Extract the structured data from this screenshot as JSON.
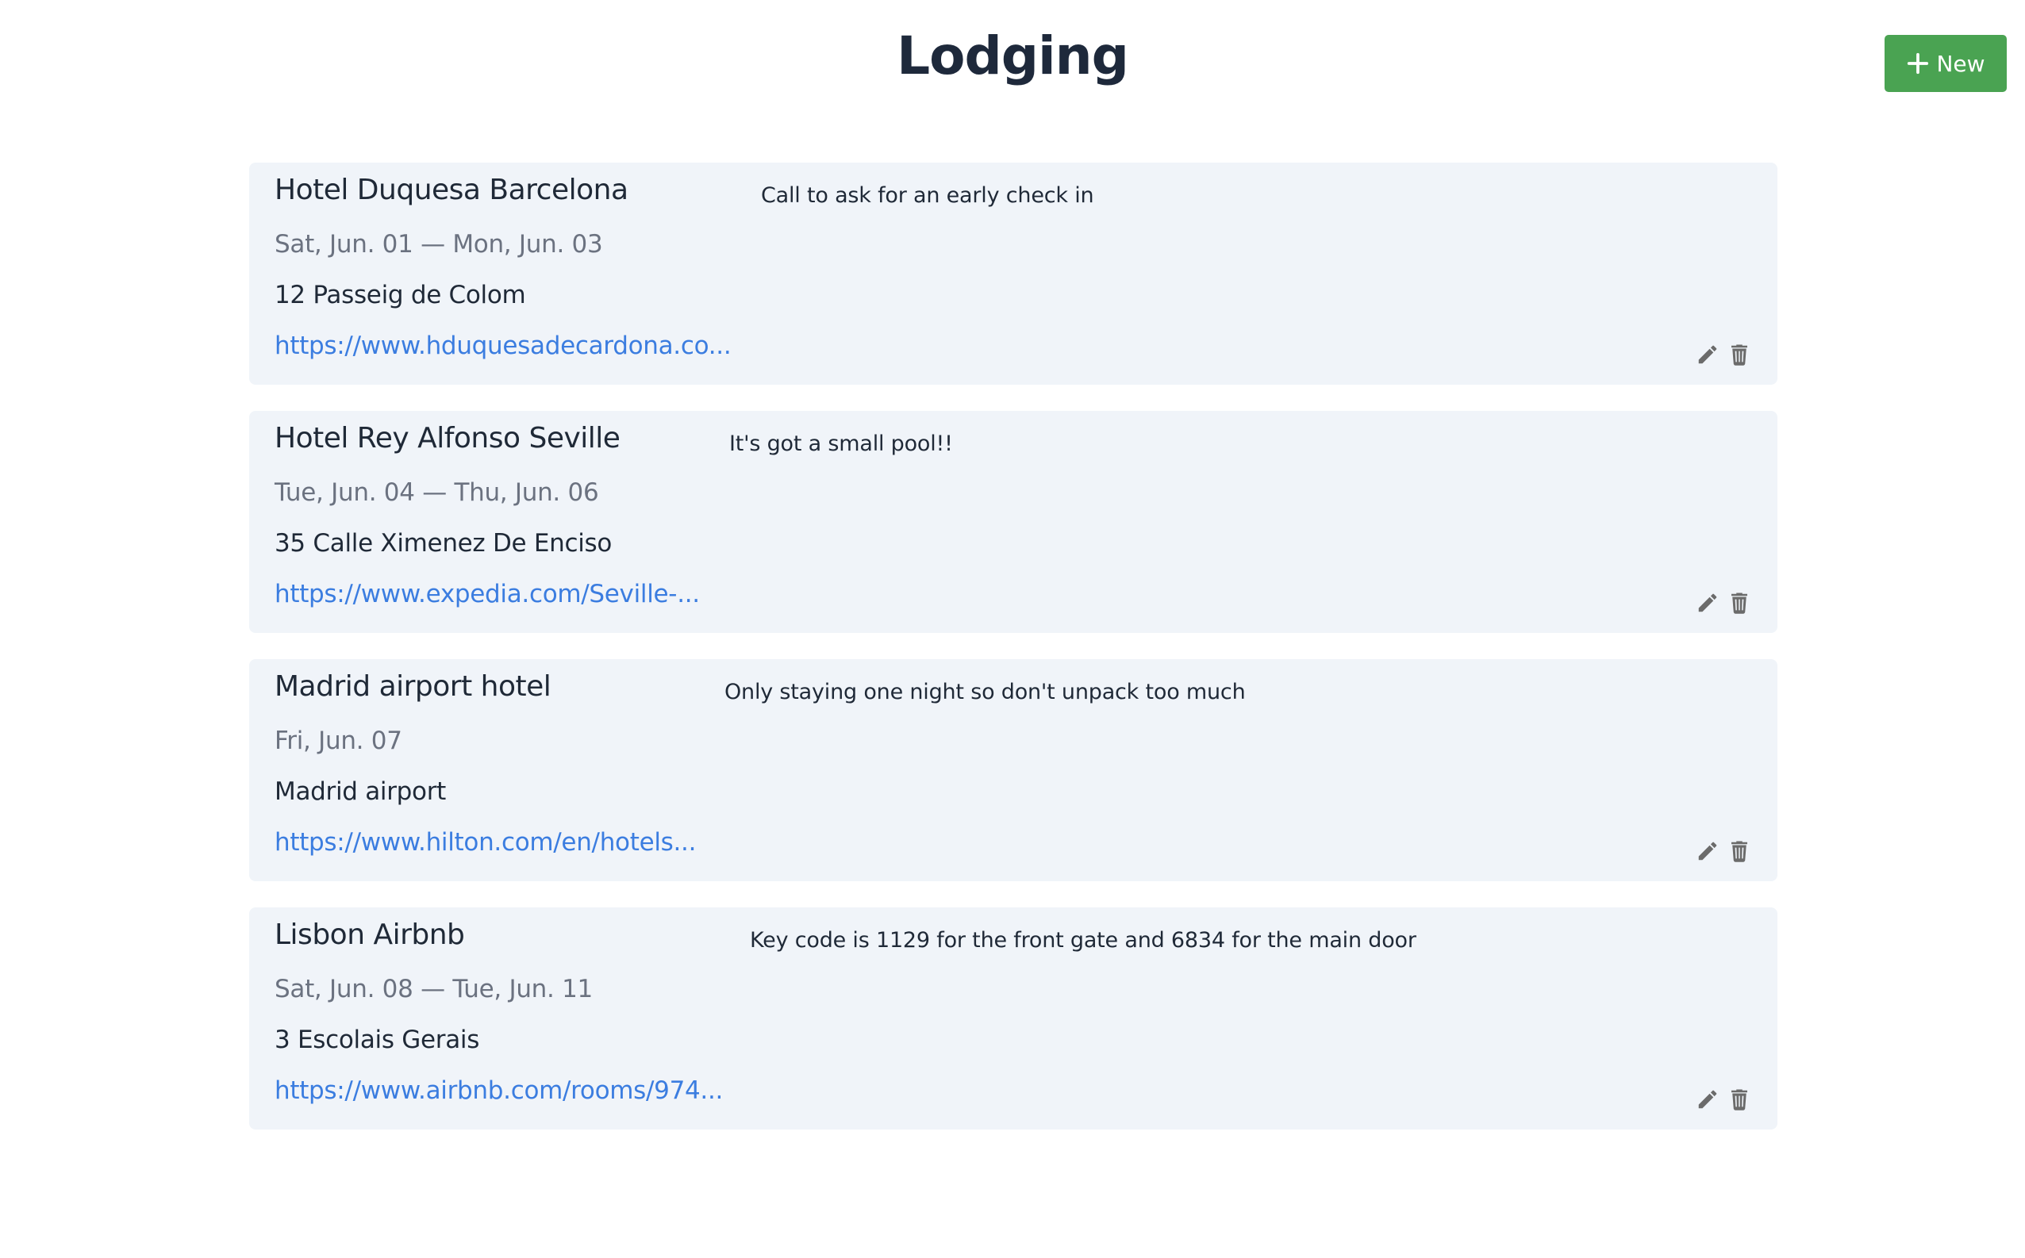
{
  "header": {
    "title": "Lodging",
    "new_label": "New",
    "accent_color": "#4aa352"
  },
  "lodgings": [
    {
      "name": "Hotel Duquesa Barcelona",
      "dates": "Sat, Jun. 01 — Mon, Jun. 03",
      "address": "12 Passeig de Colom",
      "link": "https://www.hduquesadecardona.co...",
      "note": "Call to ask for an early check in"
    },
    {
      "name": "Hotel Rey Alfonso Seville",
      "dates": "Tue, Jun. 04 — Thu, Jun. 06",
      "address": "35 Calle Ximenez De Enciso",
      "link": "https://www.expedia.com/Seville-...",
      "note": "It's got a small pool!!"
    },
    {
      "name": "Madrid airport hotel",
      "dates": "Fri, Jun. 07",
      "address": "Madrid airport",
      "link": "https://www.hilton.com/en/hotels...",
      "note": "Only staying one night so don't unpack too much"
    },
    {
      "name": "Lisbon Airbnb",
      "dates": "Sat, Jun. 08 — Tue, Jun. 11",
      "address": "3 Escolais Gerais",
      "link": "https://www.airbnb.com/rooms/974...",
      "note": "Key code is 1129 for the front gate and 6834 for the main door"
    }
  ],
  "icons": {
    "new": "plus-icon",
    "edit": "pencil-icon",
    "delete": "trash-icon"
  },
  "colors": {
    "card_background": "#f0f4f9",
    "link": "#3b7de0",
    "muted_text": "#6b7280",
    "icon": "#6b6b6b"
  }
}
